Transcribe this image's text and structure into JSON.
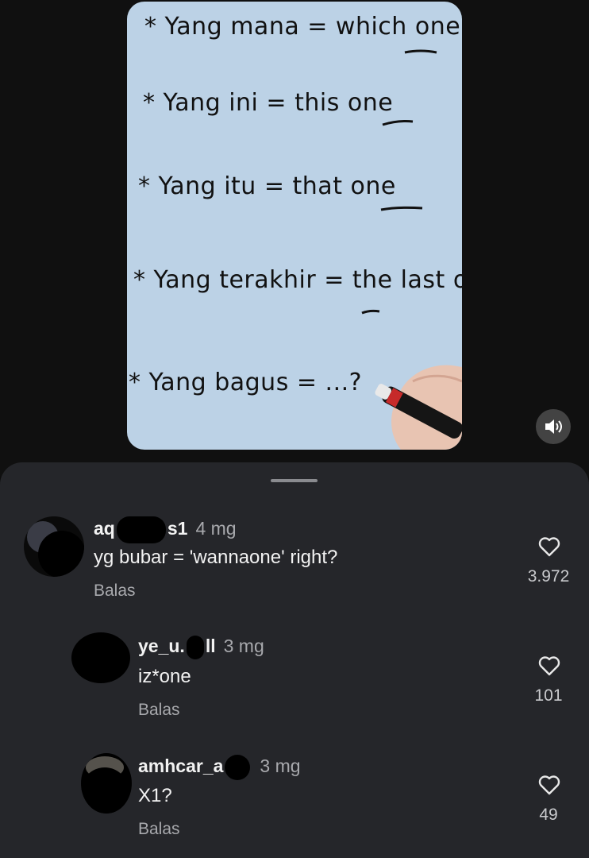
{
  "video": {
    "lines": [
      "* Yang mana = which one?",
      "* Yang ini = this one",
      "* Yang itu = that one",
      "* Yang terakhir = the last one",
      "* Yang bagus = ...?"
    ],
    "board_color": "#bcd2e6",
    "volume_icon": "speaker-icon"
  },
  "comments": [
    {
      "user_start": "aq",
      "user_end": "s1",
      "time": "4 mg",
      "text": "yg bubar = 'wannaone' right?",
      "reply": "Balas",
      "likes": "3.972"
    },
    {
      "user_start": "ye_u.",
      "user_end": "ll",
      "time": "3 mg",
      "text": "iz*one",
      "reply": "Balas",
      "likes": "101"
    },
    {
      "user_start": "amhcar_a",
      "user_end": "",
      "time": "3 mg",
      "text": "X1?",
      "reply": "Balas",
      "likes": "49"
    }
  ],
  "colors": {
    "sheet": "#25262a",
    "text": "#f2f2f2",
    "muted": "#a8a9ad"
  }
}
